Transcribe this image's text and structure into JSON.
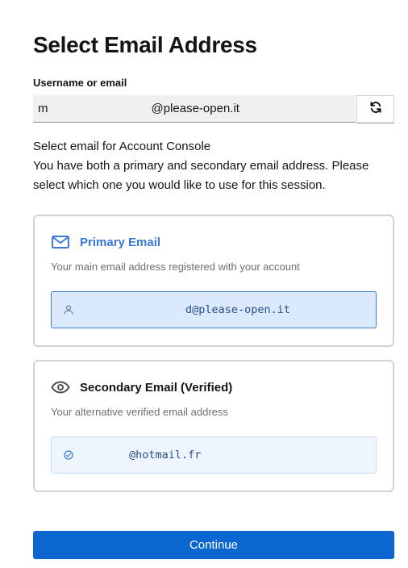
{
  "page": {
    "title": "Select Email Address"
  },
  "username": {
    "label": "Username or email",
    "value_prefix": "m",
    "value_suffix": "@please-open.it",
    "reset_icon": "refresh-icon"
  },
  "info": {
    "line1": "Select email for Account Console",
    "line2": "You have both a primary and secondary email address. Please select which one you would like to use for this session."
  },
  "primary_card": {
    "icon": "mail-icon",
    "title": "Primary Email",
    "description": "Your main email address registered with your account",
    "email_icon": "user-icon",
    "email": "d@please-open.it",
    "selected": true
  },
  "secondary_card": {
    "icon": "eye-icon",
    "title": "Secondary Email (Verified)",
    "description": "Your alternative verified email address",
    "email_icon": "check-circle-icon",
    "email": "@hotmail.fr",
    "selected": false
  },
  "actions": {
    "continue_label": "Continue"
  },
  "colors": {
    "accent": "#0c66cf",
    "primary_title": "#3a78d6",
    "selected_bg": "#dbe9fc"
  }
}
